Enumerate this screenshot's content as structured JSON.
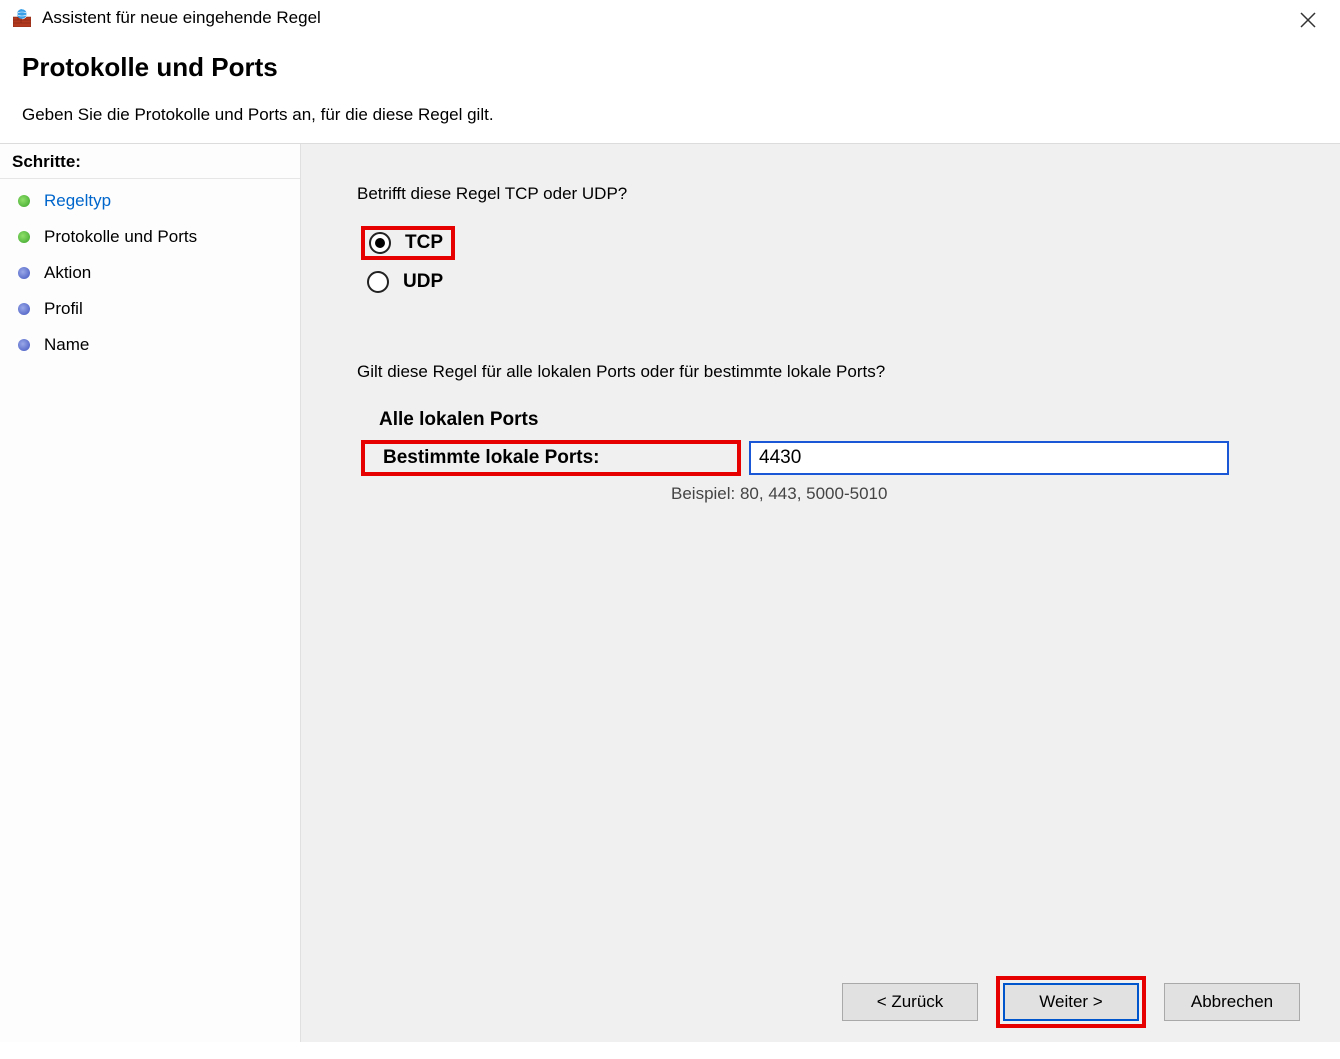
{
  "window": {
    "title": "Assistent für neue eingehende Regel"
  },
  "header": {
    "heading": "Protokolle und Ports",
    "subheading": "Geben Sie die Protokolle und Ports an, für die diese Regel gilt."
  },
  "sidebar": {
    "title": "Schritte:",
    "steps": [
      {
        "label": "Regeltyp",
        "state": "done",
        "link": true
      },
      {
        "label": "Protokolle und Ports",
        "state": "done",
        "link": false
      },
      {
        "label": "Aktion",
        "state": "pending",
        "link": false
      },
      {
        "label": "Profil",
        "state": "pending",
        "link": false
      },
      {
        "label": "Name",
        "state": "pending",
        "link": false
      }
    ]
  },
  "main": {
    "q1": "Betrifft diese Regel TCP oder UDP?",
    "protocol_options": {
      "tcp": "TCP",
      "udp": "UDP"
    },
    "q2": "Gilt diese Regel für alle lokalen Ports oder für bestimmte lokale Ports?",
    "port_options": {
      "all": "Alle lokalen Ports",
      "specific": "Bestimmte lokale Ports:"
    },
    "port_value": "4430",
    "example": "Beispiel: 80, 443, 5000-5010"
  },
  "buttons": {
    "back": "< Zurück",
    "next": "Weiter >",
    "cancel": "Abbrechen"
  }
}
